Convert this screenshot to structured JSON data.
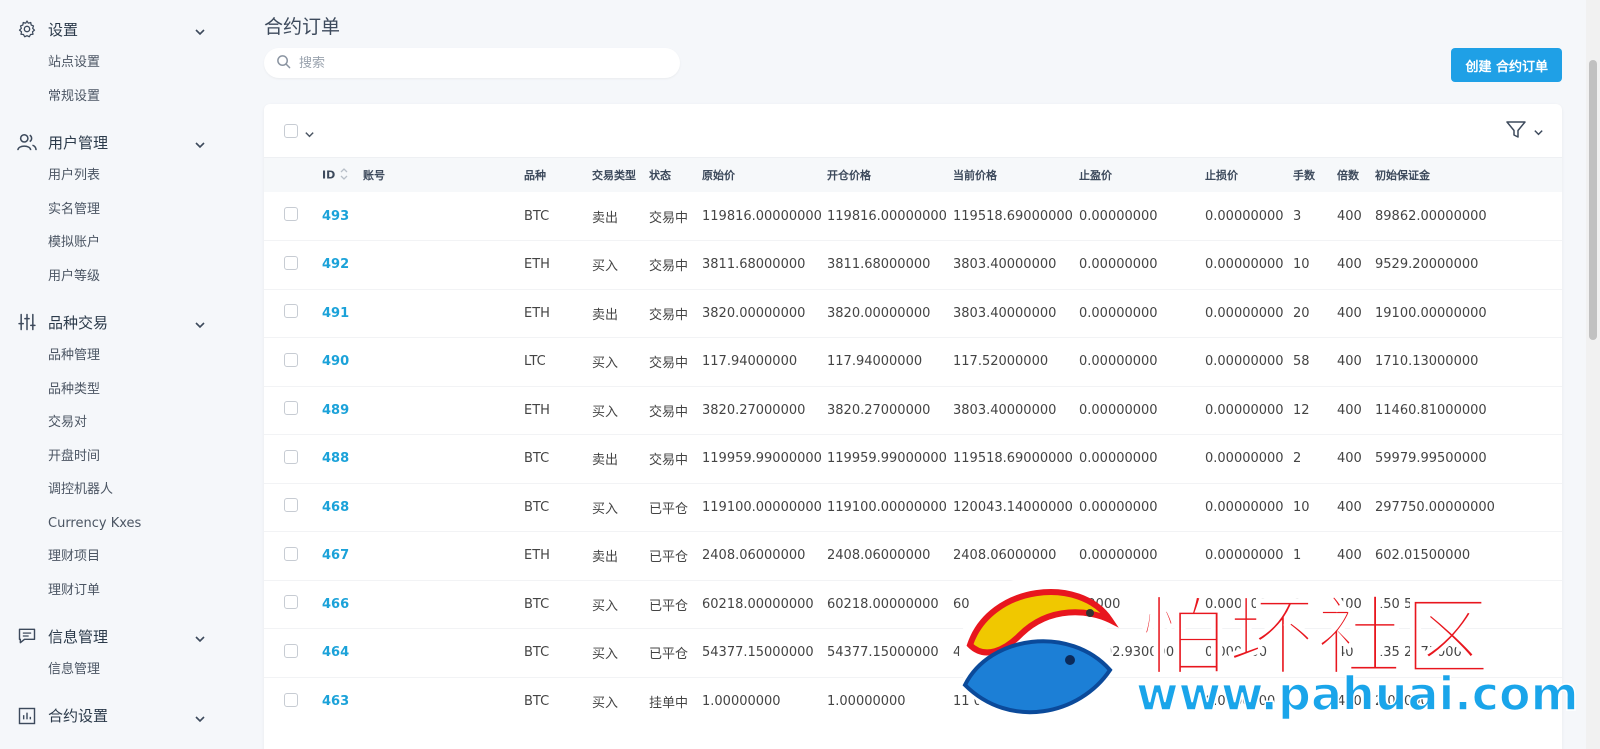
{
  "sidebar": {
    "groups": [
      {
        "label": "设置",
        "icon": "gear-icon",
        "items": [
          "站点设置",
          "常规设置"
        ]
      },
      {
        "label": "用户管理",
        "icon": "users-icon",
        "items": [
          "用户列表",
          "实名管理",
          "模拟账户",
          "用户等级"
        ]
      },
      {
        "label": "品种交易",
        "icon": "sliders-icon",
        "items": [
          "品种管理",
          "品种类型",
          "交易对",
          "开盘时间",
          "调控机器人",
          "Currency Kxes",
          "理财项目",
          "理财订单"
        ]
      },
      {
        "label": "信息管理",
        "icon": "message-icon",
        "items": [
          "信息管理"
        ]
      },
      {
        "label": "合约设置",
        "icon": "chart-icon",
        "items": []
      }
    ]
  },
  "page": {
    "title": "合约订单",
    "search_placeholder": "搜索",
    "create_label": "创建 合约订单"
  },
  "table": {
    "columns": [
      "ID",
      "账号",
      "品种",
      "交易类型",
      "状态",
      "原始价",
      "开仓价格",
      "当前价格",
      "止盈价",
      "止损价",
      "手数",
      "倍数",
      "初始保证金"
    ],
    "rows": [
      {
        "id": "493",
        "account": "",
        "symbol": "BTC",
        "type": "卖出",
        "status": "交易中",
        "orig": "119816.00000000",
        "open": "119816.00000000",
        "cur": "119518.69000000",
        "tp": "0.00000000",
        "sl": "0.00000000",
        "lots": "3",
        "mult": "400",
        "margin": "89862.00000000"
      },
      {
        "id": "492",
        "account": "",
        "symbol": "ETH",
        "type": "买入",
        "status": "交易中",
        "orig": "3811.68000000",
        "open": "3811.68000000",
        "cur": "3803.40000000",
        "tp": "0.00000000",
        "sl": "0.00000000",
        "lots": "10",
        "mult": "400",
        "margin": "9529.20000000"
      },
      {
        "id": "491",
        "account": "",
        "symbol": "ETH",
        "type": "卖出",
        "status": "交易中",
        "orig": "3820.00000000",
        "open": "3820.00000000",
        "cur": "3803.40000000",
        "tp": "0.00000000",
        "sl": "0.00000000",
        "lots": "20",
        "mult": "400",
        "margin": "19100.00000000"
      },
      {
        "id": "490",
        "account": "",
        "symbol": "LTC",
        "type": "买入",
        "status": "交易中",
        "orig": "117.94000000",
        "open": "117.94000000",
        "cur": "117.52000000",
        "tp": "0.00000000",
        "sl": "0.00000000",
        "lots": "58",
        "mult": "400",
        "margin": "1710.13000000"
      },
      {
        "id": "489",
        "account": "",
        "symbol": "ETH",
        "type": "买入",
        "status": "交易中",
        "orig": "3820.27000000",
        "open": "3820.27000000",
        "cur": "3803.40000000",
        "tp": "0.00000000",
        "sl": "0.00000000",
        "lots": "12",
        "mult": "400",
        "margin": "11460.81000000"
      },
      {
        "id": "488",
        "account": "",
        "symbol": "BTC",
        "type": "卖出",
        "status": "交易中",
        "orig": "119959.99000000",
        "open": "119959.99000000",
        "cur": "119518.69000000",
        "tp": "0.00000000",
        "sl": "0.00000000",
        "lots": "2",
        "mult": "400",
        "margin": "59979.99500000"
      },
      {
        "id": "468",
        "account": "",
        "symbol": "BTC",
        "type": "买入",
        "status": "已平仓",
        "orig": "119100.00000000",
        "open": "119100.00000000",
        "cur": "120043.14000000",
        "tp": "0.00000000",
        "sl": "0.00000000",
        "lots": "10",
        "mult": "400",
        "margin": "297750.00000000"
      },
      {
        "id": "467",
        "account": "",
        "symbol": "ETH",
        "type": "卖出",
        "status": "已平仓",
        "orig": "2408.06000000",
        "open": "2408.06000000",
        "cur": "2408.06000000",
        "tp": "0.00000000",
        "sl": "0.00000000",
        "lots": "1",
        "mult": "400",
        "margin": "602.01500000"
      },
      {
        "id": "466",
        "account": "",
        "symbol": "BTC",
        "type": "买入",
        "status": "已平仓",
        "orig": "60218.00000000",
        "open": "60218.00000000",
        "cur": "60",
        "tp": "00000",
        "sl": "0.000000",
        "lots": "0",
        "mult": "400",
        "margin": "150 50.0000000"
      },
      {
        "id": "464",
        "account": "",
        "symbol": "BTC",
        "type": "买入",
        "status": "已平仓",
        "orig": "54377.15000000",
        "open": "54377.15000000",
        "cur": "4122000",
        "tp": "54402.930000",
        "sl": "0.000000",
        "lots": "",
        "mult": "40",
        "margin": "135 2875000"
      },
      {
        "id": "463",
        "account": "",
        "symbol": "BTC",
        "type": "买入",
        "status": "挂单中",
        "orig": "1.00000000",
        "open": "1.00000000",
        "cur": "11 00000",
        "tp": "",
        "sl": "0.0000000",
        "lots": "",
        "mult": "400",
        "margin": "2 00000"
      }
    ]
  },
  "watermark": {
    "text": "怕坏社区",
    "url": "www.pahuai.com"
  }
}
